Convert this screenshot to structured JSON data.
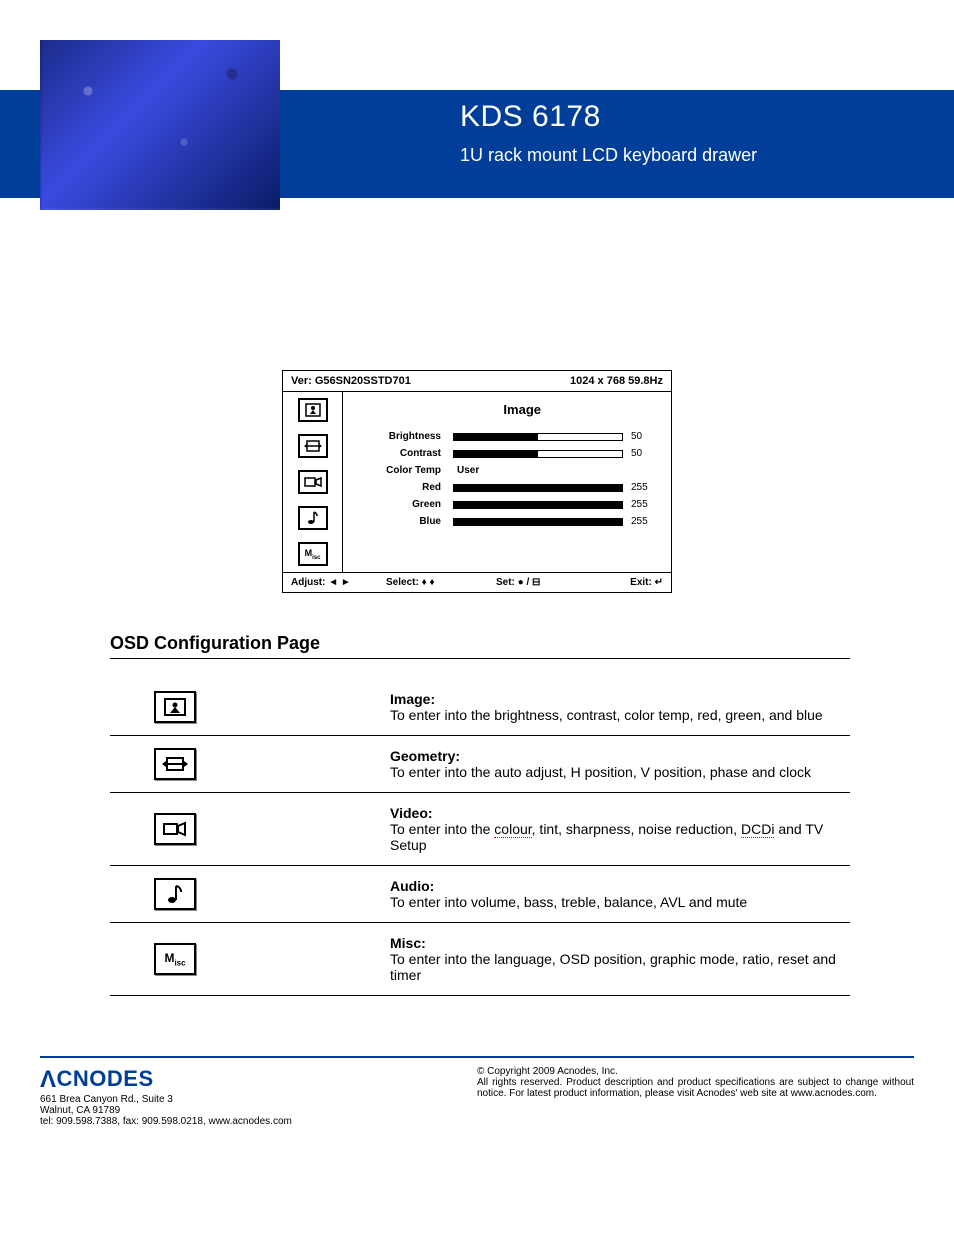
{
  "header": {
    "title": "KDS 6178",
    "subtitle": "1U rack mount LCD keyboard drawer"
  },
  "osd": {
    "version_label": "Ver: G56SN20SSTD701",
    "resolution": "1024 x 768  59.8Hz",
    "heading": "Image",
    "rows": [
      {
        "label": "Brightness",
        "value": 50,
        "max": 100
      },
      {
        "label": "Contrast",
        "value": 50,
        "max": 100
      },
      {
        "label": "Color Temp",
        "text": "User"
      },
      {
        "label": "Red",
        "value": 255,
        "max": 255
      },
      {
        "label": "Green",
        "value": 255,
        "max": 255
      },
      {
        "label": "Blue",
        "value": 255,
        "max": 255
      }
    ],
    "side_icons": [
      "image",
      "geometry",
      "video",
      "audio",
      "misc"
    ],
    "bottom": {
      "adjust": "Adjust: ◄ ►",
      "select": "Select: ♦ ♦",
      "set": "Set: ● / ⊟",
      "exit": "Exit: ↵"
    }
  },
  "section_title": "OSD Configuration Page",
  "config_rows": [
    {
      "icon": "image",
      "title": "Image:",
      "desc_pre": "To enter into the brightness, contrast, color temp, red, green, and blue",
      "desc_dotted": "",
      "desc_post": ""
    },
    {
      "icon": "geometry",
      "title": "Geometry:",
      "desc_pre": "To enter into the auto adjust, H position, V position, phase and clock",
      "desc_dotted": "",
      "desc_post": ""
    },
    {
      "icon": "video",
      "title": "Video:",
      "desc_pre": "To enter into the ",
      "desc_dotted": "colour",
      "desc_mid": ", tint, sharpness, noise reduction, ",
      "desc_dotted2": "DCDi",
      "desc_post": " and TV Setup"
    },
    {
      "icon": "audio",
      "title": "Audio:",
      "desc_pre": "To enter into volume, bass, treble, balance, AVL and mute",
      "desc_dotted": "",
      "desc_post": ""
    },
    {
      "icon": "misc",
      "title": "Misc:",
      "desc_pre": "To enter into the language, OSD position, graphic mode, ratio, reset and timer",
      "desc_dotted": "",
      "desc_post": ""
    }
  ],
  "footer": {
    "logo": "CNODES",
    "addr1": "661 Brea Canyon Rd., Suite 3",
    "addr2": "Walnut, CA 91789",
    "addr3": "tel: 909.598.7388, fax: 909.598.0218, www.acnodes.com",
    "copy": "© Copyright 2009 Acnodes, Inc.",
    "legal": "All rights reserved. Product description and product specifications are subject to change without notice. For latest product information, please visit Acnodes' web site at www.acnodes.com."
  }
}
